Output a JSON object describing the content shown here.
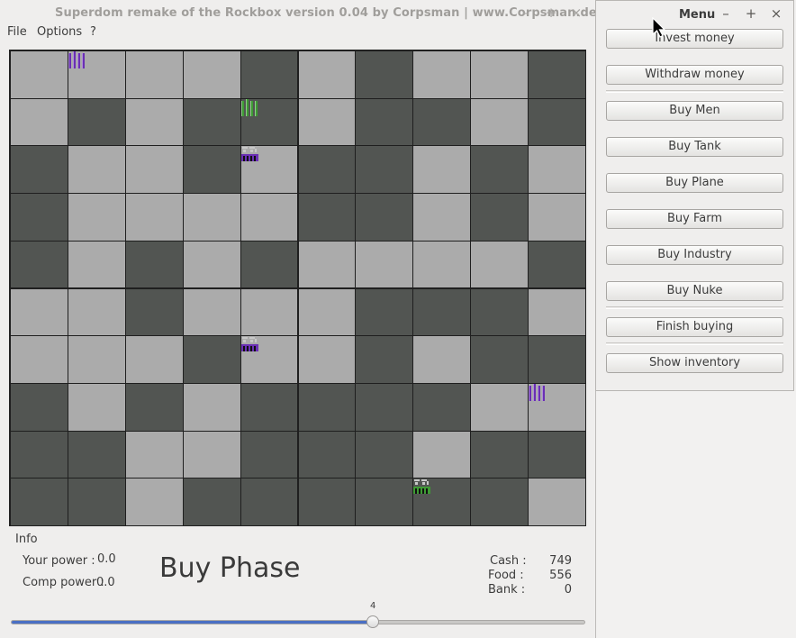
{
  "main_window": {
    "title": "Superdom remake of the Rockbox version 0.04 by Corpsman | www.Corpsman.de |",
    "controls": {
      "minimize": "–",
      "maximize": "+",
      "close": "×"
    }
  },
  "menubar": {
    "items": [
      "File",
      "Options",
      "?"
    ]
  },
  "colors": {
    "light_cell": "#ababab",
    "dark_cell": "#525552",
    "player": "#6a2fb4",
    "computer": "#3e9b34"
  },
  "board": {
    "cols": 10,
    "rows": 10,
    "cells": [
      "LLLLDLDLLD",
      "LDLDDLDDLD",
      "DLLDLDDLDL",
      "DLLLLDDLDL",
      "DLDLDLLLLD",
      "LLDLLLDDDL",
      "LLLDLLDLDD",
      "DLDLDDDDLL",
      "DDLLDDDLDD",
      "DDLDDDDDDL"
    ],
    "pieces": [
      {
        "row": 0,
        "col": 1,
        "type": "men",
        "owner": "player"
      },
      {
        "row": 1,
        "col": 4,
        "type": "men",
        "owner": "computer"
      },
      {
        "row": 2,
        "col": 4,
        "type": "factory",
        "owner": "player"
      },
      {
        "row": 6,
        "col": 4,
        "type": "factory",
        "owner": "player"
      },
      {
        "row": 7,
        "col": 9,
        "type": "men",
        "owner": "player"
      },
      {
        "row": 9,
        "col": 7,
        "type": "factory",
        "owner": "computer"
      }
    ]
  },
  "info": {
    "heading": "Info",
    "your_power_label": "Your power :",
    "your_power_value": "0.0",
    "comp_power_label": "Comp power :",
    "comp_power_value": "0.0",
    "phase": "Buy Phase",
    "cash_label": "Cash :",
    "cash_value": "749",
    "food_label": "Food :",
    "food_value": "556",
    "bank_label": "Bank :",
    "bank_value": "0"
  },
  "slider": {
    "value": "4",
    "fraction": 0.63
  },
  "menu_window": {
    "title": "Menu",
    "controls": {
      "minimize": "–",
      "maximize": "+",
      "close": "×"
    },
    "buttons": {
      "invest": "Invest money",
      "withdraw": "Withdraw money",
      "buy_men": "Buy Men",
      "buy_tank": "Buy Tank",
      "buy_plane": "Buy Plane",
      "buy_farm": "Buy Farm",
      "buy_industry": "Buy Industry",
      "buy_nuke": "Buy Nuke",
      "finish_buying": "Finish buying",
      "show_inventory": "Show inventory"
    }
  }
}
